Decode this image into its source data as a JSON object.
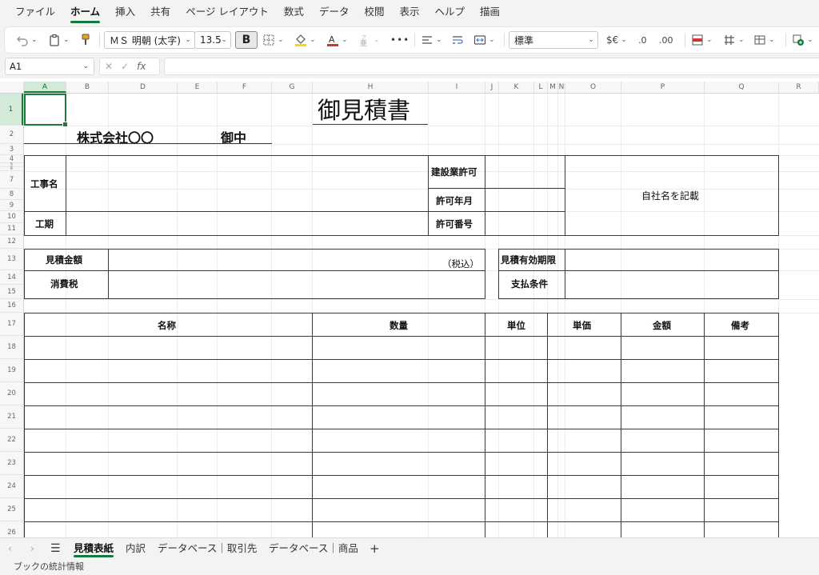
{
  "ribbon": {
    "tabs": [
      "ファイル",
      "ホーム",
      "挿入",
      "共有",
      "ページ レイアウト",
      "数式",
      "データ",
      "校閲",
      "表示",
      "ヘルプ",
      "描画"
    ],
    "active_tab": "ホーム"
  },
  "toolbar": {
    "font_name": "ＭＳ 明朝 (太字)",
    "font_size": "13.5",
    "bold_label": "B",
    "number_format": "標準",
    "currency_label": "$€",
    "inc_decimal_label": ".0",
    "dec_decimal_label": ".00",
    "more_label": "•••",
    "font_color": "#d13438",
    "fill_color": "#ffd400",
    "accent": "#117a3c"
  },
  "formula_bar": {
    "name_box": "A1",
    "fx_label": "fx",
    "formula": ""
  },
  "grid": {
    "columns": [
      "A",
      "B",
      "D",
      "E",
      "F",
      "G",
      "H",
      "I",
      "J",
      "K",
      "L",
      "M",
      "N",
      "O",
      "P",
      "Q",
      "R"
    ],
    "rows": [
      "1",
      "2",
      "3",
      "4",
      "5",
      "6",
      "7",
      "8",
      "9",
      "10",
      "11",
      "12",
      "13",
      "14",
      "15",
      "16",
      "17",
      "18",
      "19",
      "20",
      "21",
      "22",
      "23",
      "24",
      "25",
      "26"
    ],
    "selected_column": "A",
    "selected_row": "1"
  },
  "sheet": {
    "title": "御見積書",
    "customer": "株式会社〇〇",
    "honorific": "御中",
    "project_name_label": "工事名",
    "period_label": "工期",
    "license_label": "建設業許可",
    "license_date_label": "許可年月",
    "license_number_label": "許可番号",
    "company_placeholder": "自社名を記載",
    "estimate_amount_label": "見積金額",
    "tax_included_note": "（税込）",
    "consumption_tax_label": "消費税",
    "validity_label": "見積有効期限",
    "payment_terms_label": "支払条件",
    "table_headers": [
      "名称",
      "数量",
      "単位",
      "単価",
      "金額",
      "備考"
    ]
  },
  "sheet_tabs": {
    "tabs": [
      "見積表紙",
      "内訳",
      "データベース｜取引先",
      "データベース｜商品"
    ],
    "active": "見積表紙",
    "add_label": "+"
  },
  "status_bar": {
    "text": "ブックの統計情報"
  }
}
